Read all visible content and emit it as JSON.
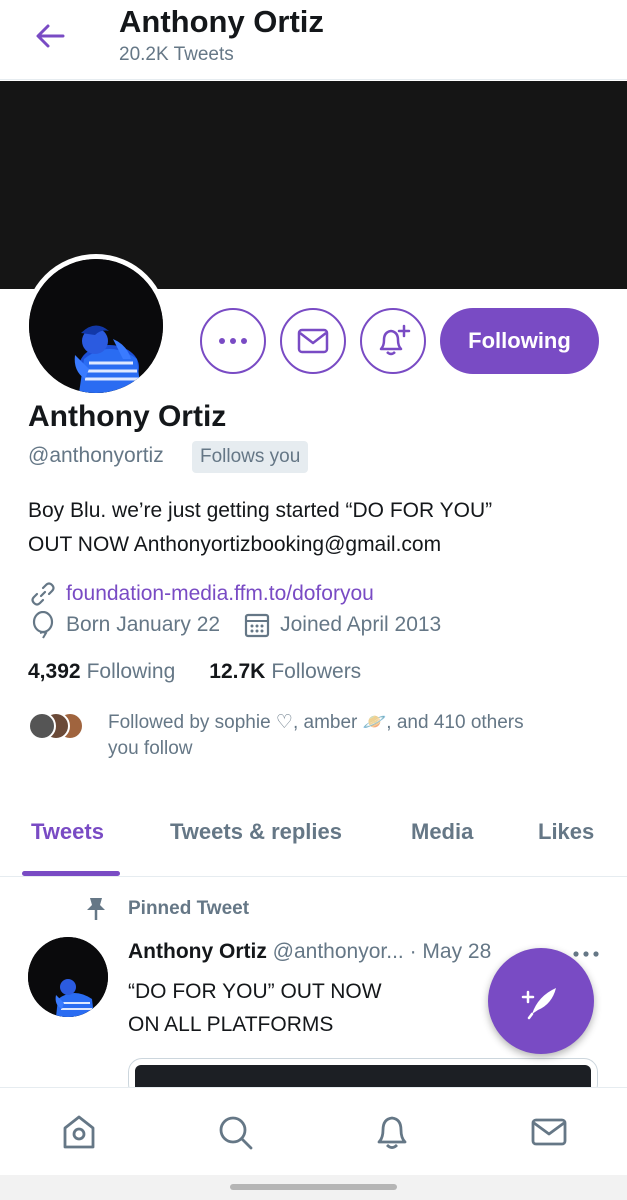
{
  "colors": {
    "accent": "#794bc4",
    "text": "#14171a",
    "secondary": "#657786",
    "border": "#e6ecf0"
  },
  "header": {
    "title": "Anthony Ortiz",
    "tweet_count": "20.2K Tweets",
    "back_icon": "arrow-left-icon"
  },
  "profile": {
    "name": "Anthony Ortiz",
    "handle": "@anthonyortiz",
    "follows_you": "Follows you",
    "bio_line1": "Boy Blu. we’re just getting started  “DO FOR YOU”",
    "bio_line2": "OUT NOW Anthonyortizbooking@gmail.com",
    "link": "foundation-media.ffm.to/doforyou",
    "born": "Born January 22",
    "joined": "Joined April 2013",
    "following_count": "4,392",
    "following_label": "Following",
    "followers_count": "12.7K",
    "followers_label": "Followers",
    "followed_by_line1": "Followed by sophie ♡, amber 🪐, and 410 others",
    "followed_by_line2": "you follow"
  },
  "actions": {
    "more_icon": "more-horizontal-icon",
    "message_icon": "envelope-icon",
    "notify_icon": "bell-plus-icon",
    "following_label": "Following"
  },
  "tabs": [
    {
      "label": "Tweets",
      "active": true
    },
    {
      "label": "Tweets & replies",
      "active": false
    },
    {
      "label": "Media",
      "active": false
    },
    {
      "label": "Likes",
      "active": false
    }
  ],
  "pinned_tweet": {
    "pinned_label": "Pinned Tweet",
    "author": "Anthony Ortiz",
    "handle_and_date": "@anthonyor... · May 28",
    "text": "“DO FOR YOU” OUT NOW\nON ALL PLATFORMS"
  },
  "fab": {
    "icon": "compose-feather-icon"
  },
  "bottom_nav": [
    {
      "icon": "home-icon"
    },
    {
      "icon": "search-icon"
    },
    {
      "icon": "bell-icon"
    },
    {
      "icon": "mail-icon"
    }
  ]
}
